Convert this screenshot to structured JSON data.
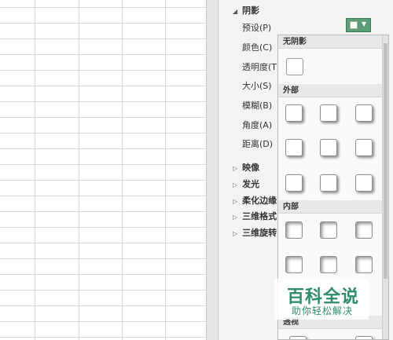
{
  "shadow_section": {
    "title": "阴影",
    "properties": [
      "预设(P)",
      "颜色(C)",
      "透明度(T)",
      "大小(S)",
      "模糊(B)",
      "角度(A)",
      "距离(D)"
    ]
  },
  "collapsed_groups": [
    "映像",
    "发光",
    "柔化边缘",
    "三维格式",
    "三维旋转"
  ],
  "dropdown": {
    "no_shadow": "无阴影",
    "outer": "外部",
    "inner": "内部",
    "perspective": "透视"
  },
  "watermark": {
    "title": "百科全说",
    "subtitle": "助你轻松解决"
  },
  "colors": {
    "accent": "#5b9f76",
    "watermark": "#2f8c6f"
  }
}
